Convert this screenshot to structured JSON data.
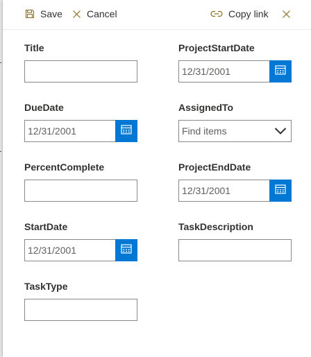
{
  "toolbar": {
    "save_label": "Save",
    "cancel_label": "Cancel",
    "copy_link_label": "Copy link"
  },
  "form": {
    "title": {
      "label": "Title",
      "value": ""
    },
    "project_start_date": {
      "label": "ProjectStartDate",
      "value": "12/31/2001"
    },
    "due_date": {
      "label": "DueDate",
      "value": "12/31/2001"
    },
    "assigned_to": {
      "label": "AssignedTo",
      "placeholder": "Find items"
    },
    "percent_complete": {
      "label": "PercentComplete",
      "value": ""
    },
    "project_end_date": {
      "label": "ProjectEndDate",
      "value": "12/31/2001"
    },
    "start_date": {
      "label": "StartDate",
      "value": "12/31/2001"
    },
    "task_description": {
      "label": "TaskDescription",
      "value": ""
    },
    "task_type": {
      "label": "TaskType",
      "value": ""
    }
  },
  "icons": {
    "save": "save-icon",
    "cancel": "close-icon",
    "copy_link": "link-icon",
    "close": "close-icon",
    "calendar": "calendar-icon",
    "dropdown": "chevron-down-icon"
  },
  "colors": {
    "accent": "#0078d4",
    "toolbar_icon": "#8a6d1f",
    "text": "#323130",
    "field_border": "#8a8886"
  }
}
